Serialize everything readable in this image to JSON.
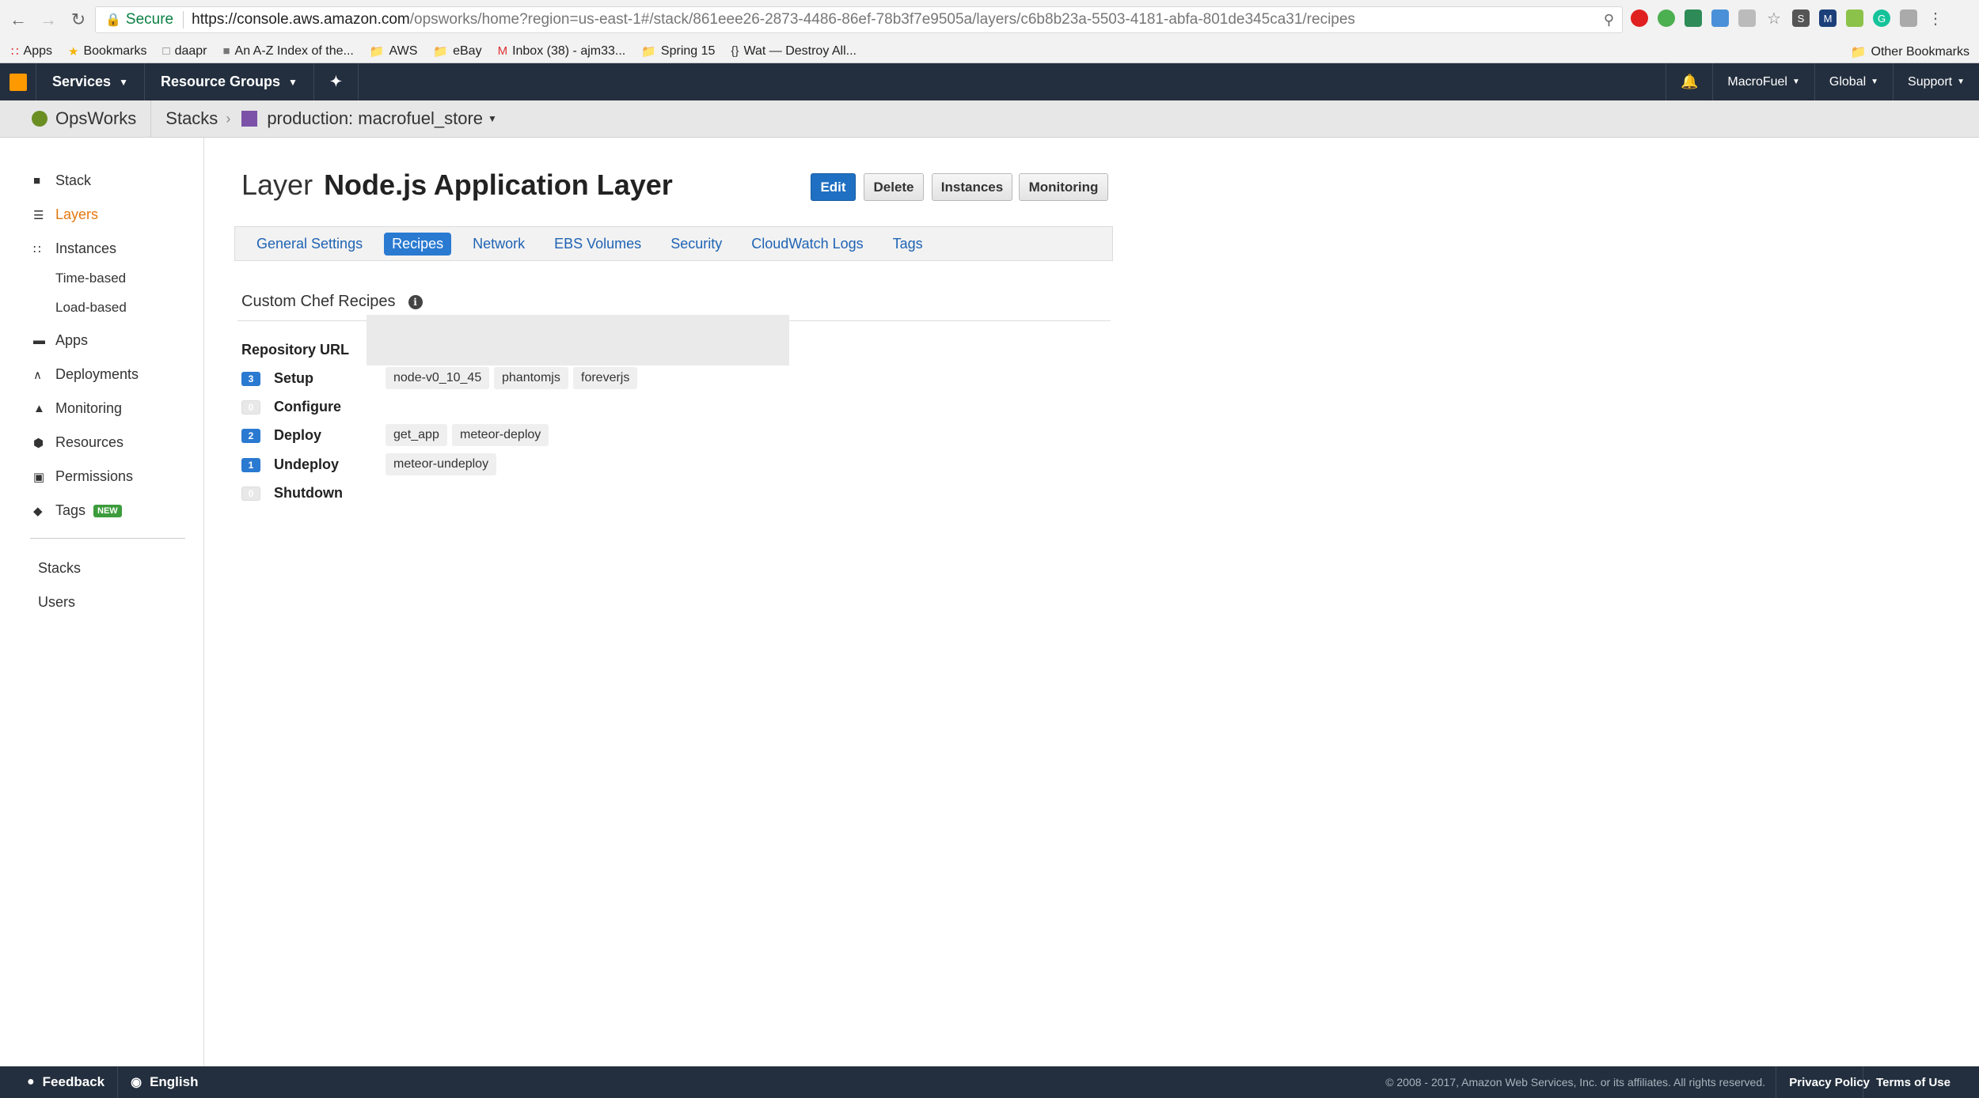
{
  "browser": {
    "secure_label": "Secure",
    "url_host": "https://console.aws.amazon.com",
    "url_path": "/opsworks/home?region=us-east-1#/stack/861eee26-2873-4486-86ef-78b3f7e9505a/layers/c6b8b23a-5503-4181-abfa-801de345ca31/recipes",
    "bookmarks": [
      "Apps",
      "Bookmarks",
      "daapr",
      "An A-Z Index of the...",
      "AWS",
      "eBay",
      "Inbox (38) - ajm33...",
      "Spring 15",
      "Wat — Destroy All..."
    ],
    "other_bookmarks": "Other Bookmarks"
  },
  "awsnav": {
    "services": "Services",
    "resource_groups": "Resource Groups",
    "account": "MacroFuel",
    "region": "Global",
    "support": "Support"
  },
  "breadcrumb": {
    "service": "OpsWorks",
    "stacks": "Stacks",
    "stack_name": "production: macrofuel_store"
  },
  "sidebar": {
    "items": [
      {
        "label": "Stack",
        "icon": "stack-icon"
      },
      {
        "label": "Layers",
        "icon": "layers-icon"
      },
      {
        "label": "Instances",
        "icon": "instances-icon"
      },
      {
        "label": "Time-based"
      },
      {
        "label": "Load-based"
      },
      {
        "label": "Apps",
        "icon": "apps-icon"
      },
      {
        "label": "Deployments",
        "icon": "deployments-icon"
      },
      {
        "label": "Monitoring",
        "icon": "monitoring-icon"
      },
      {
        "label": "Resources",
        "icon": "resources-icon"
      },
      {
        "label": "Permissions",
        "icon": "lock-icon"
      },
      {
        "label": "Tags",
        "icon": "tag-icon",
        "badge": "NEW"
      }
    ],
    "bottom": [
      "Stacks",
      "Users"
    ]
  },
  "page": {
    "title_prefix": "Layer",
    "title_name": "Node.js Application Layer",
    "buttons": [
      "Edit",
      "Delete",
      "Instances",
      "Monitoring"
    ],
    "tabs": [
      "General Settings",
      "Recipes",
      "Network",
      "EBS Volumes",
      "Security",
      "CloudWatch Logs",
      "Tags"
    ],
    "active_tab": "Recipes",
    "section_title": "Custom Chef Recipes",
    "repo_label": "Repository URL",
    "events": [
      {
        "count": "3",
        "label": "Setup",
        "recipes": [
          "node-v0_10_45",
          "phantomjs",
          "foreverjs"
        ]
      },
      {
        "count": "0",
        "label": "Configure",
        "recipes": []
      },
      {
        "count": "2",
        "label": "Deploy",
        "recipes": [
          "get_app",
          "meteor-deploy"
        ]
      },
      {
        "count": "1",
        "label": "Undeploy",
        "recipes": [
          "meteor-undeploy"
        ]
      },
      {
        "count": "0",
        "label": "Shutdown",
        "recipes": []
      }
    ]
  },
  "footer": {
    "feedback": "Feedback",
    "language": "English",
    "copyright": "© 2008 - 2017, Amazon Web Services, Inc. or its affiliates. All rights reserved.",
    "privacy": "Privacy Policy",
    "terms": "Terms of Use"
  },
  "colors": {
    "aws_nav": "#232f3e",
    "accent_orange": "#e47911",
    "primary_blue": "#1f70c2"
  }
}
